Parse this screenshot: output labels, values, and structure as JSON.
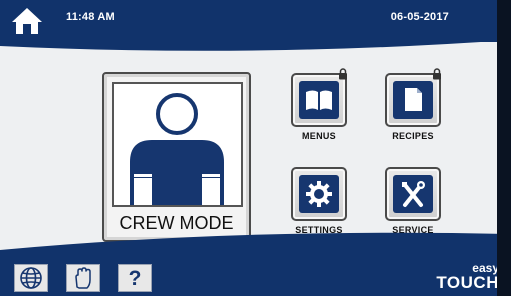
{
  "header": {
    "time": "11:48 AM",
    "date": "06-05-2017",
    "home_icon": "home-icon"
  },
  "main": {
    "crew_mode_label": "CREW MODE",
    "tiles": [
      {
        "label": "MENUS",
        "icon": "book-icon",
        "locked": true
      },
      {
        "label": "RECIPES",
        "icon": "document-icon",
        "locked": true
      },
      {
        "label": "SETTINGS",
        "icon": "gear-icon",
        "locked": false
      },
      {
        "label": "SERVICE",
        "icon": "tools-icon",
        "locked": false
      }
    ]
  },
  "footer": {
    "buttons": [
      "globe-icon",
      "hand-icon",
      "question-icon"
    ],
    "help_glyph": "?",
    "brand_line1": "easy",
    "brand_line2": "TOUCH"
  },
  "colors": {
    "primary_blue": "#11336b",
    "bezel": "#0a1322",
    "screen_bg": "#eef0f2"
  }
}
